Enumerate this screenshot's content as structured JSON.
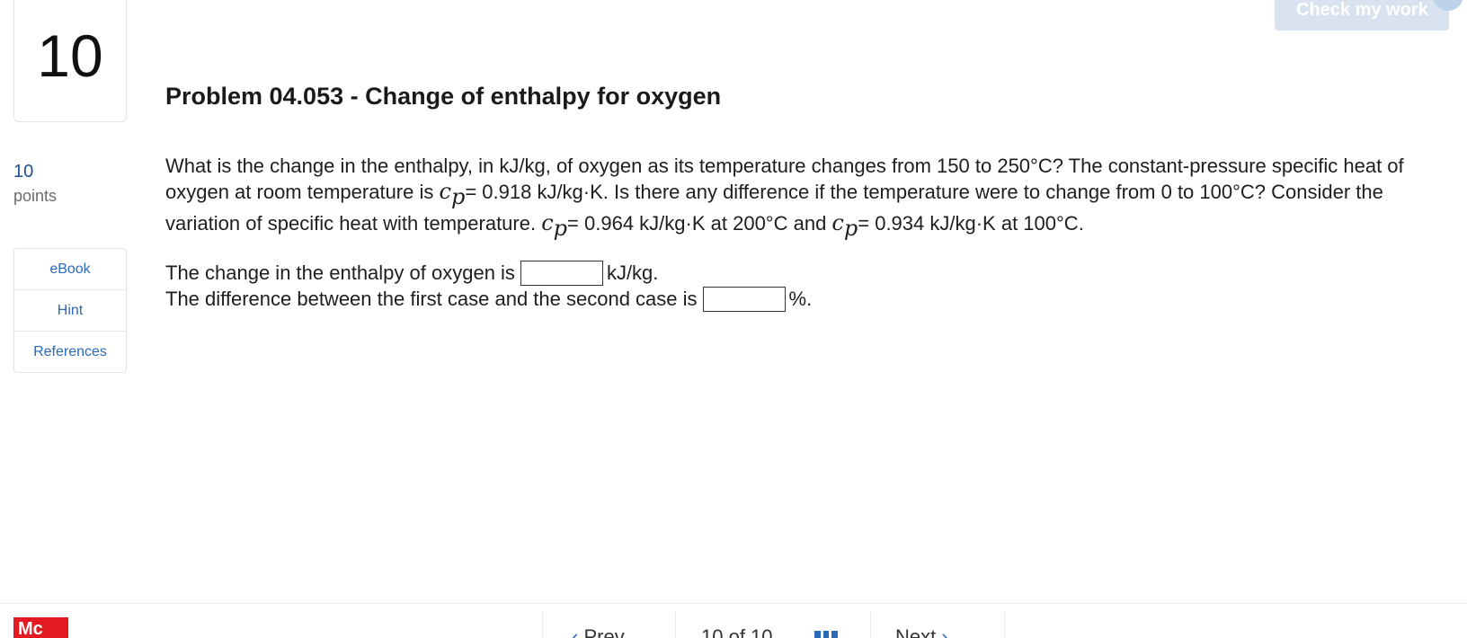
{
  "question": {
    "number": "10",
    "points_value": "10",
    "points_label": "points",
    "title": "Problem 04.053 - Change of enthalpy for oxygen",
    "text_parts": {
      "p1": "What is the change in the enthalpy, in kJ/kg, of oxygen as its temperature changes from 150 to 250°C? The constant-pressure specific heat of oxygen at room temperature is ",
      "cp1": "c",
      "cp1_sub": "p",
      "p2": "= 0.918 kJ/kg·K. Is there any difference if the temperature were to change from 0 to 100°C? Consider the variation of specific heat with temperature. ",
      "cp2": "c",
      "cp2_sub": "p",
      "p3": "= 0.964 kJ/kg·K at 200°C and ",
      "cp3": "c",
      "cp3_sub": "p",
      "p4": "= 0.934 kJ/kg·K at 100°C."
    }
  },
  "answers": {
    "line1_prefix": "The change in the enthalpy of oxygen is",
    "line1_suffix": "kJ/kg.",
    "line1_value": "",
    "line2_prefix": "The difference between the first case and the second case is",
    "line2_suffix": "%.",
    "line2_value": ""
  },
  "header": {
    "check_button_label": "Check my work"
  },
  "sidebar": {
    "items": [
      {
        "label": "eBook"
      },
      {
        "label": "Hint"
      },
      {
        "label": "References"
      }
    ]
  },
  "footer": {
    "logo_text": "Mc",
    "prev_label": "Prev",
    "count_text": "10 of 10",
    "next_label": "Next"
  },
  "colors": {
    "accent": "#2a6ab8",
    "points": "#1f4e99",
    "check_button_bg": "#d9e3f0",
    "logo_red": "#e21a22"
  }
}
